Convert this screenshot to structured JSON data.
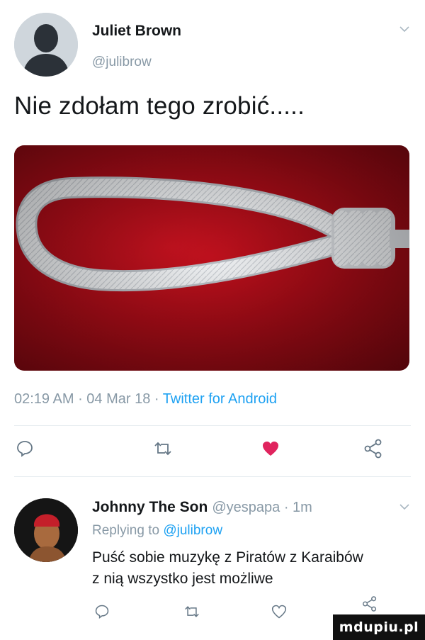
{
  "tweet": {
    "author_name": "Juliet Brown",
    "author_handle": "@julibrow",
    "text": "Nie zdołam tego zrobić.....",
    "timestamp_time": "02:19 AM",
    "timestamp_sep1": " · ",
    "timestamp_date": "04 Mar 18",
    "timestamp_sep2": " · ",
    "source": "Twitter for Android",
    "liked": true
  },
  "actions": {
    "reply_icon": "reply-icon",
    "retweet_icon": "retweet-icon",
    "like_icon": "heart-icon",
    "share_icon": "share-icon"
  },
  "reply": {
    "author_name": "Johnny The Son",
    "author_handle": "@yespapa · 1m",
    "replying_prefix": "Replying to ",
    "replying_to": "@julibrow",
    "text_line1": "Puść sobie muzykę z Piratów z Karaibów",
    "text_line2": "z nią wszystko jest możliwe"
  },
  "watermark": "mdupiu.pl",
  "colors": {
    "accent": "#1da1f2",
    "muted": "#8899a6",
    "like": "#e0245e",
    "media_bg": "#b10d18"
  }
}
